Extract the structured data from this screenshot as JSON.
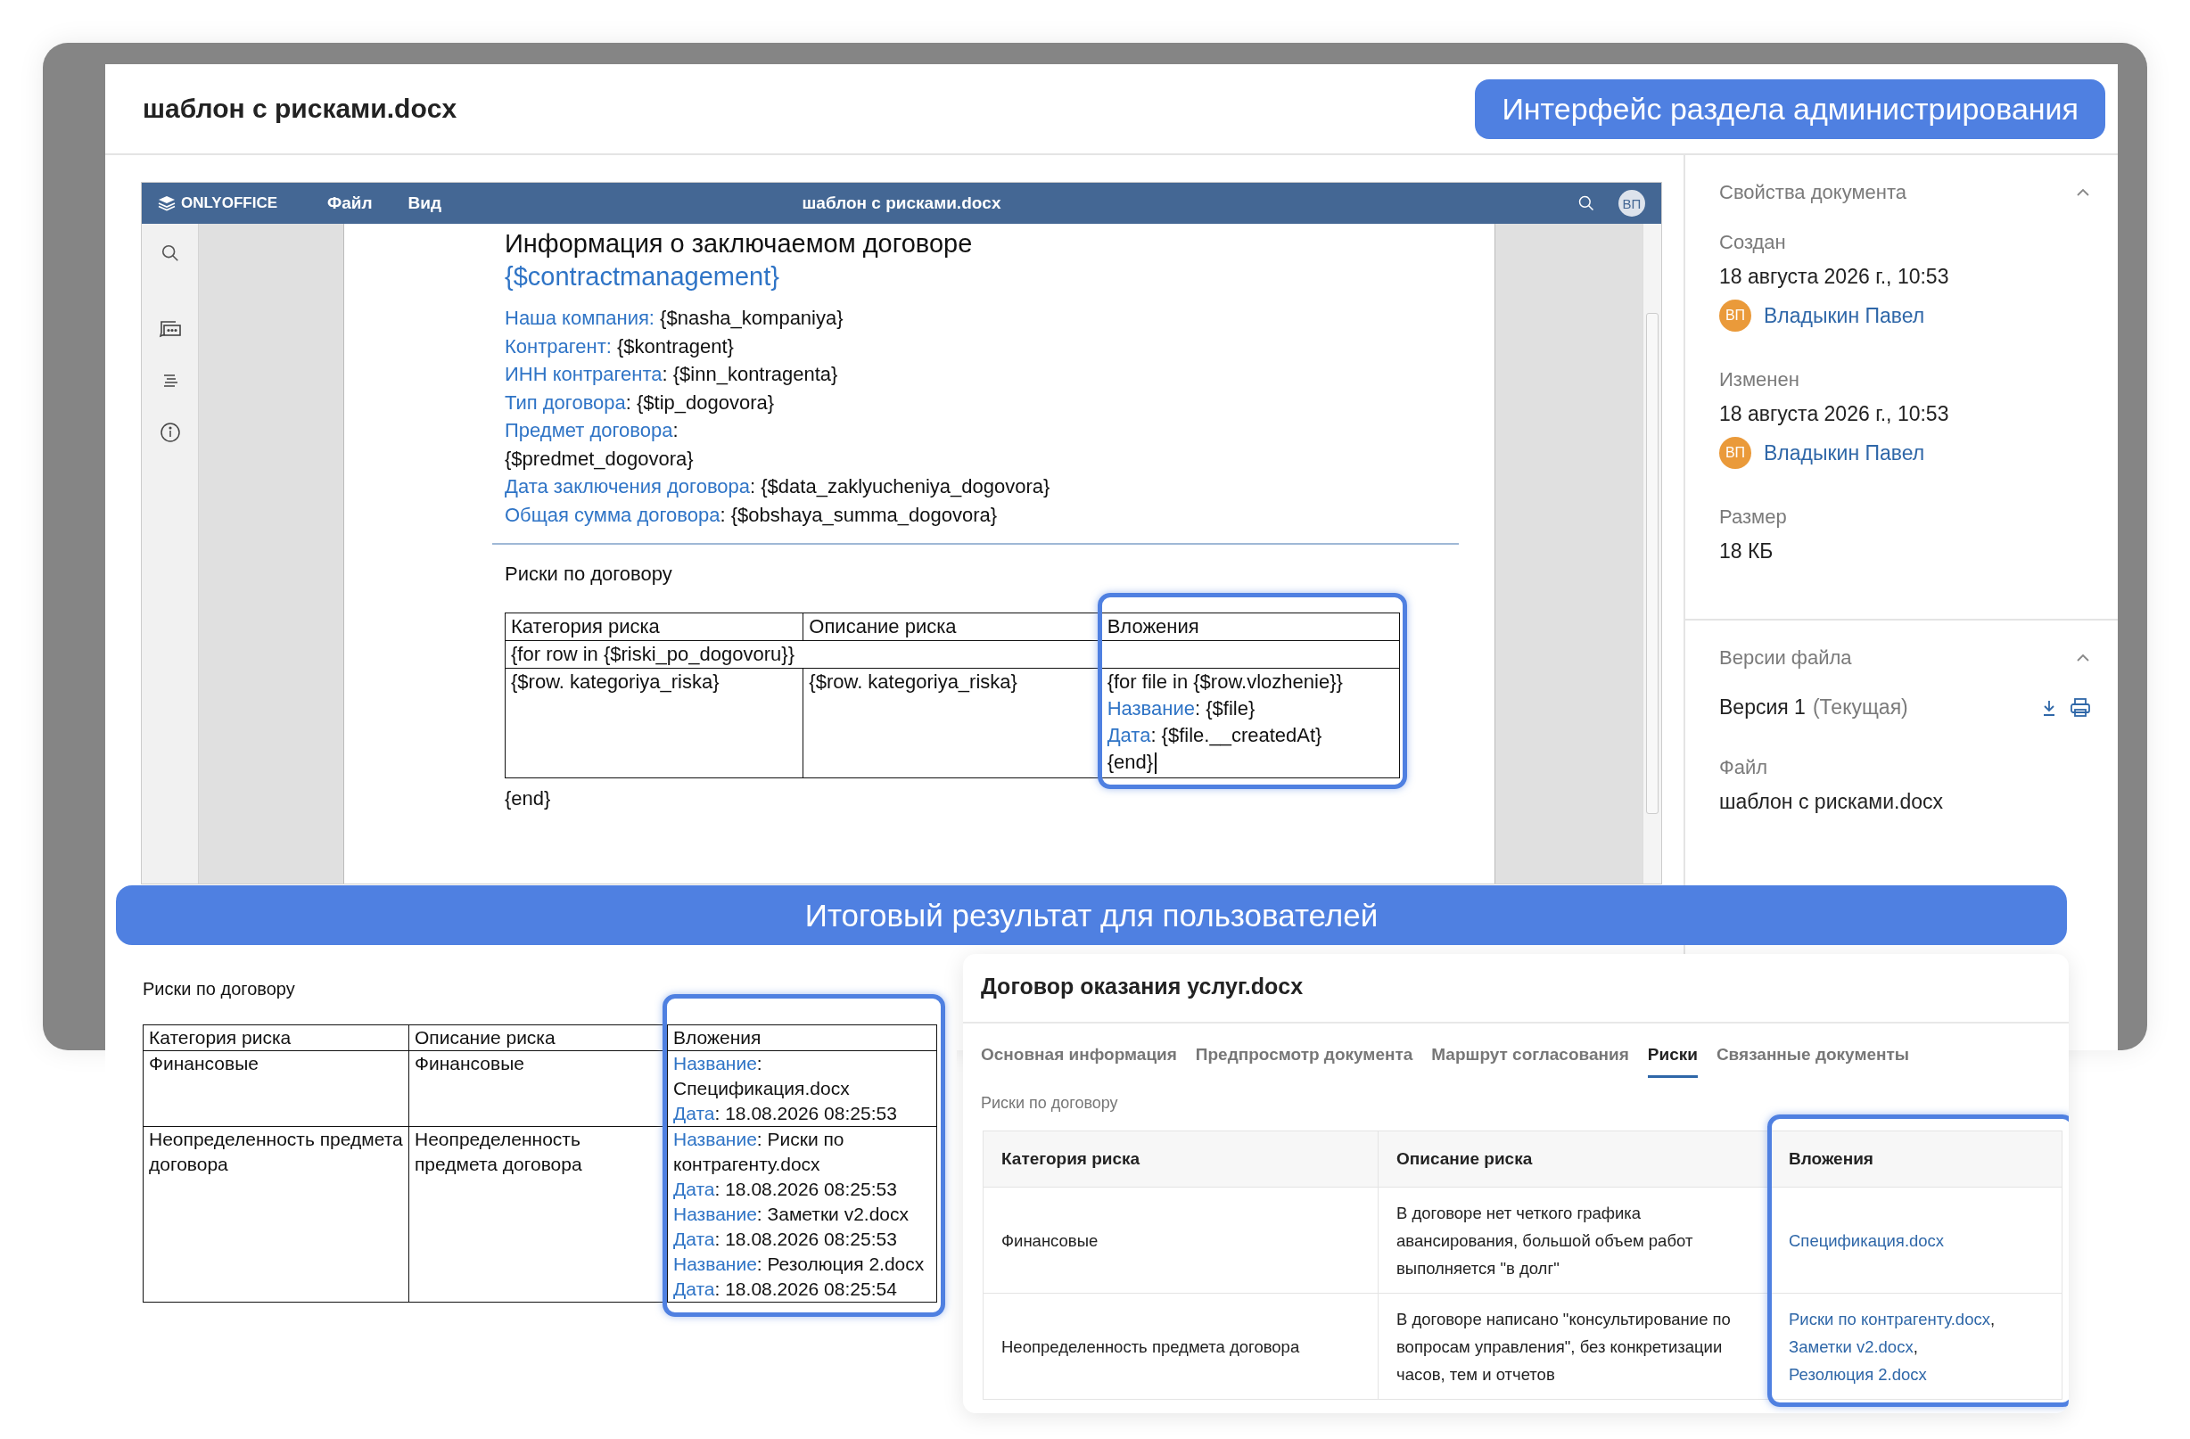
{
  "window": {
    "title": "шаблон с рисками.docx"
  },
  "admin_badge": "Интерфейс раздела администрирования",
  "editor": {
    "logo": "ONLYOFFICE",
    "menu": [
      "Файл",
      "Вид"
    ],
    "title": "шаблон с рисками.docx",
    "avatar": "ВП",
    "document": {
      "heading": "Информация о заключаемом договоре",
      "tag": "{$contractmanagement}",
      "fields": [
        {
          "label": "Наша компания:",
          "value": " {$nasha_kompaniya}",
          "kind": "inline"
        },
        {
          "label": "Контрагент:",
          "value": " {$kontragent}",
          "kind": "inline"
        },
        {
          "label": "ИНН контрагента",
          "value": ": {$inn_kontragenta}",
          "kind": "inline"
        },
        {
          "label": "Тип договора",
          "value": ": {$tip_dogovora}",
          "kind": "inline"
        },
        {
          "label": "Предмет договора",
          "value": ":",
          "kind": "inline"
        },
        {
          "value": "{$predmet_dogovora}",
          "kind": "plain"
        },
        {
          "label": "Дата заключения договора",
          "value": ": {$data_zaklyucheniya_dogovora}",
          "kind": "inline"
        },
        {
          "label": "Общая сумма договора",
          "value": ": {$obshaya_summa_dogovora}",
          "kind": "inline"
        }
      ],
      "section_title": "Риски по договору",
      "table": {
        "columns": [
          "Категория риска",
          "Описание риска",
          "Вложения"
        ],
        "loop_start": "{for row in {$riski_po_dogovoru}}",
        "cells": [
          "{$row. kategoriya_riska}",
          "{$row. kategoriya_riska}"
        ],
        "attachment_lines": [
          {
            "text": "{for file in {$row.vlozhenie}}"
          },
          {
            "label": "Название",
            "text": ": {$file}"
          },
          {
            "label": "Дата",
            "text": ": {$file.__createdAt}"
          },
          {
            "text": "{end}",
            "cursor": true
          }
        ],
        "loop_end": "{end}"
      }
    }
  },
  "properties": {
    "title": "Свойства документа",
    "expanded": true,
    "entries": [
      {
        "kind": "person",
        "label": "Создан",
        "value": "18 августа 2026 г., 10:53",
        "avatar": "ВП",
        "author": "Владыкин Павел"
      },
      {
        "kind": "person",
        "label": "Изменен",
        "value": "18 августа 2026 г., 10:53",
        "avatar": "ВП",
        "author": "Владыкин Павел"
      },
      {
        "kind": "plain",
        "label": "Размер",
        "value": "18 КБ"
      }
    ]
  },
  "versions": {
    "title": "Версии файла",
    "expanded": true,
    "version": "Версия 1",
    "status": "(Текущая)",
    "file_label": "Файл",
    "file_name": "шаблон с рисками.docx"
  },
  "result_banner": "Итоговый результат для пользователей",
  "result_document": {
    "title": "Риски по договору",
    "columns": [
      "Категория риска",
      "Описание риска",
      "Вложения"
    ],
    "rows": [
      {
        "category": "Финансовые",
        "description": "Финансовые",
        "attachments": [
          {
            "label": "Название",
            "text": ": Спецификация.docx"
          },
          {
            "label": "Дата",
            "text": ": 18.08.2026 08:25:53"
          }
        ]
      },
      {
        "category": "Неопределенность предмета договора",
        "description": "Неопределенность предмета договора",
        "attachments": [
          {
            "label": "Название",
            "text": ": Риски по контрагенту.docx"
          },
          {
            "label": "Дата",
            "text": ": 18.08.2026 08:25:53"
          },
          {
            "label": "Название",
            "text": ": Заметки v2.docx"
          },
          {
            "label": "Дата",
            "text": ": 18.08.2026 08:25:53"
          },
          {
            "label": "Название",
            "text": ": Резолюция 2.docx"
          },
          {
            "label": "Дата",
            "text": ": 18.08.2026 08:25:54"
          }
        ]
      }
    ]
  },
  "card": {
    "title": "Договор оказания услуг.docx",
    "tabs": [
      {
        "label": "Основная информация",
        "selected": false
      },
      {
        "label": "Предпросмотр документа",
        "selected": false
      },
      {
        "label": "Маршрут согласования",
        "selected": false
      },
      {
        "label": "Риски",
        "selected": true
      },
      {
        "label": "Связанные документы",
        "selected": false
      }
    ],
    "section": "Риски по договору",
    "columns": [
      "Категория риска",
      "Описание риска",
      "Вложения"
    ],
    "rows": [
      {
        "category": "Финансовые",
        "description": "В договоре нет четкого графика авансирования, большой объем работ выполняется \"в долг\"",
        "attachments": [
          {
            "name": "Спецификация.docx"
          }
        ]
      },
      {
        "category": "Неопределенность предмета договора",
        "description": "В договоре написано \"консультирование по вопросам управления\", без конкретизации часов, тем и отчетов",
        "attachments": [
          {
            "name": "Риски по контрагенту.docx",
            "sep": ","
          },
          {
            "name": "Заметки v2.docx",
            "sep": ","
          },
          {
            "name": "Резолюция 2.docx"
          }
        ]
      }
    ]
  }
}
